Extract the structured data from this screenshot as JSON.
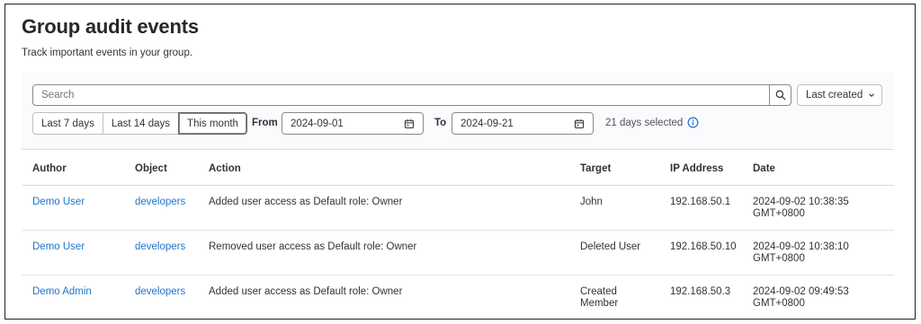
{
  "page": {
    "title": "Group audit events",
    "description": "Track important events in your group."
  },
  "filters": {
    "search_placeholder": "Search",
    "sort_label": "Last created",
    "ranges": [
      "Last 7 days",
      "Last 14 days",
      "This month"
    ],
    "selected_range": "This month",
    "from_label": "From",
    "from_value": "2024-09-01",
    "to_label": "To",
    "to_value": "2024-09-21",
    "days_selected": "21 days selected"
  },
  "table": {
    "headers": [
      "Author",
      "Object",
      "Action",
      "Target",
      "IP Address",
      "Date"
    ],
    "rows": [
      {
        "author": "Demo User",
        "object": "developers",
        "action": "Added user access as Default role: Owner",
        "target": "John",
        "ip": "192.168.50.1",
        "date": "2024-09-02 10:38:35 GMT+0800"
      },
      {
        "author": "Demo User",
        "object": "developers",
        "action": "Removed user access as Default role: Owner",
        "target": "Deleted User",
        "ip": "192.168.50.10",
        "date": "2024-09-02 10:38:10 GMT+0800"
      },
      {
        "author": "Demo Admin",
        "object": "developers",
        "action": "Added user access as Default role: Owner",
        "target": "Created Member",
        "ip": "192.168.50.3",
        "date": "2024-09-02 09:49:53 GMT+0800"
      }
    ]
  },
  "colors": {
    "link": "#1f75cb",
    "text": "#333238",
    "panel": "#fbfafd",
    "info": "#1f75cb"
  },
  "icons": {
    "search": "search-icon",
    "sort": "chevron-down-icon",
    "calendar": "calendar-icon",
    "info": "information-icon"
  }
}
